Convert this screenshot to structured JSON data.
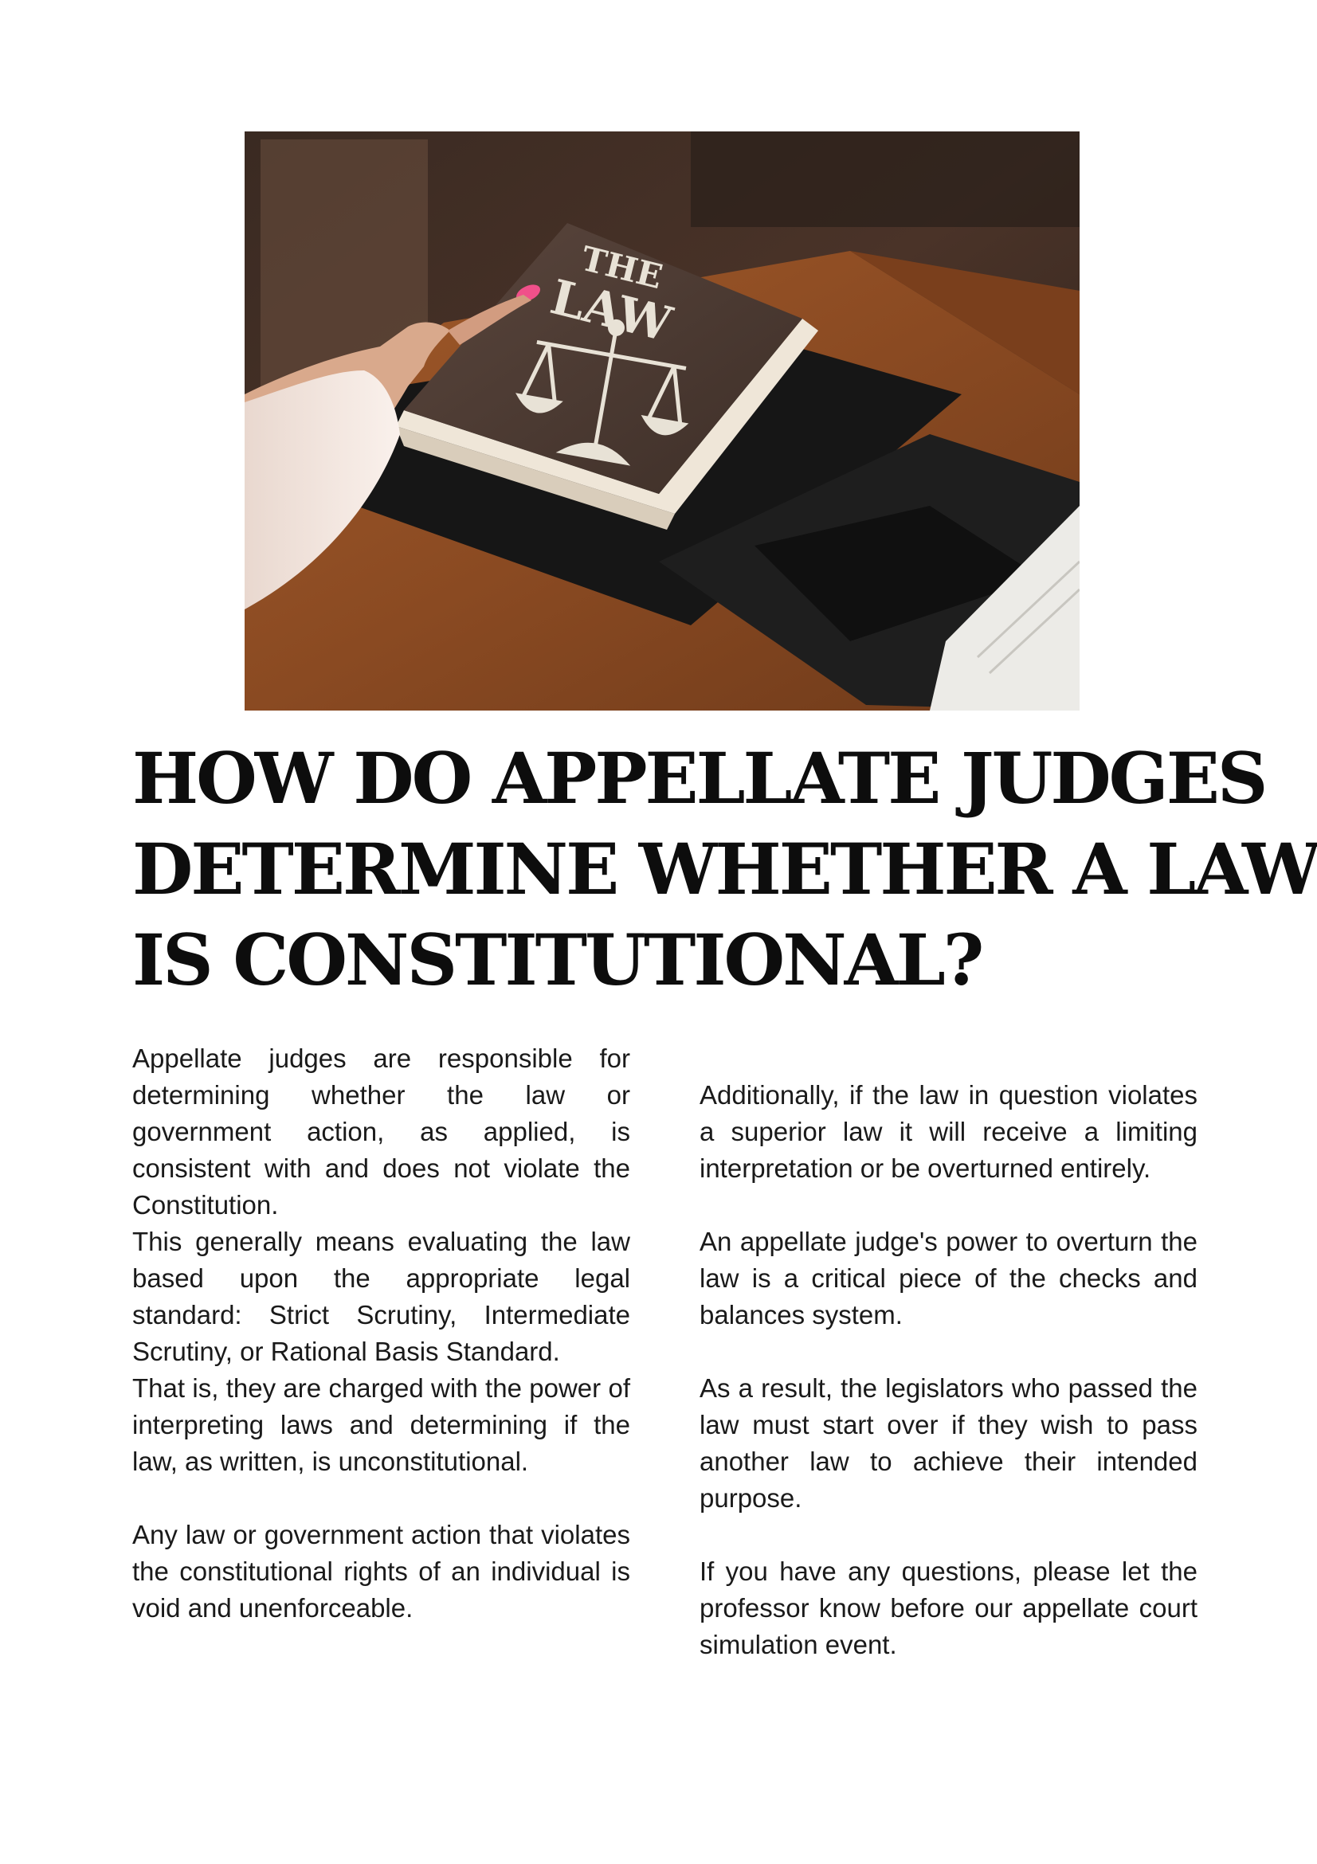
{
  "hero_image": {
    "book_title_line1": "THE",
    "book_title_line2": "LAW",
    "colors": {
      "wood": "#8a4a22",
      "book_cover": "#4a3830",
      "folder": "#1c1c1c",
      "sleeve": "#f3e5de",
      "nail": "#f0508a"
    }
  },
  "title": {
    "lines": [
      "HOW DO APPELLATE JUDGES",
      "DETERMINE WHETHER A LAW",
      "IS CONSTITUTIONAL?"
    ]
  },
  "columns": {
    "left": [
      "Appellate judges are responsible for determining whether the law or government action, as applied, is consistent with and does not violate the Constitution.",
      "This generally means evaluating the law based upon the appropriate legal standard: Strict Scrutiny, Intermediate Scrutiny, or Rational Basis Standard.",
      "That is, they are charged with the power of interpreting laws and determining if the law, as written, is unconstitutional.",
      "Any law or government action that violates the constitutional rights of an individual is void and unenforceable."
    ],
    "right": [
      "Additionally, if the law in question violates a superior law it will receive a limiting interpretation or be overturned entirely.",
      "An appellate judge's power to overturn the law is a critical piece of the checks and balances system.",
      "As a result, the legislators who passed the law must start over if they wish to pass another law to achieve their intended purpose.",
      "If you have any questions, please let the professor know before our appellate court simulation event."
    ]
  }
}
